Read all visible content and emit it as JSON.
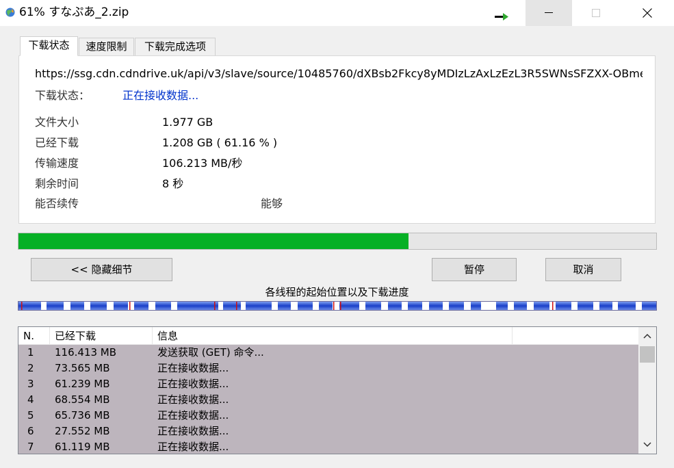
{
  "window": {
    "title": "61% すなぷあ_2.zip",
    "icons": {
      "app": "app-globe-icon",
      "arrow": "green-arrow-icon",
      "minimize": "minimize-icon",
      "maximize": "maximize-icon",
      "close": "close-icon"
    }
  },
  "tabs": [
    {
      "label": "下载状态",
      "active": true
    },
    {
      "label": "速度限制",
      "active": false
    },
    {
      "label": "下载完成选项",
      "active": false
    }
  ],
  "info": {
    "url": "https://ssg.cdn.cdndrive.uk/api/v3/slave/source/10485760/dXBsb2Fkcy8yMDIzLzAxLzEzL3R5SWNsSFZXX-OBme(",
    "status_label": "下载状态：",
    "status_value": "正在接收数据...",
    "file_size_label": "文件大小",
    "file_size_value": "1.977  GB",
    "downloaded_label": "已经下载",
    "downloaded_value": "1.208  GB  ( 61.16 % )",
    "speed_label": "传输速度",
    "speed_value": "106.213  MB/秒",
    "remaining_label": "剩余时间",
    "remaining_value": "8 秒",
    "resume_label": "能否续传",
    "resume_value": "能够"
  },
  "progress": {
    "percent": 61.16,
    "color": "#06b025"
  },
  "buttons": {
    "hide_details": "<< 隐藏细节",
    "pause": "暂停",
    "cancel": "取消"
  },
  "threads_caption": "各线程的起始位置以及下载进度",
  "list": {
    "headers": [
      "N.",
      "已经下载",
      "信息",
      ""
    ],
    "rows": [
      {
        "n": "1",
        "downloaded": "116.413  MB",
        "info": "发送获取 (GET) 命令..."
      },
      {
        "n": "2",
        "downloaded": "73.565  MB",
        "info": "正在接收数据..."
      },
      {
        "n": "3",
        "downloaded": "61.239  MB",
        "info": "正在接收数据..."
      },
      {
        "n": "4",
        "downloaded": "68.554  MB",
        "info": "正在接收数据..."
      },
      {
        "n": "5",
        "downloaded": "65.736  MB",
        "info": "正在接收数据..."
      },
      {
        "n": "6",
        "downloaded": "27.552  MB",
        "info": "正在接收数据..."
      },
      {
        "n": "7",
        "downloaded": "61.119  MB",
        "info": "正在接收数据..."
      }
    ],
    "row_background": "#bdb5bd",
    "icons": {
      "up": "scroll-up-icon",
      "down": "scroll-down-icon"
    }
  }
}
